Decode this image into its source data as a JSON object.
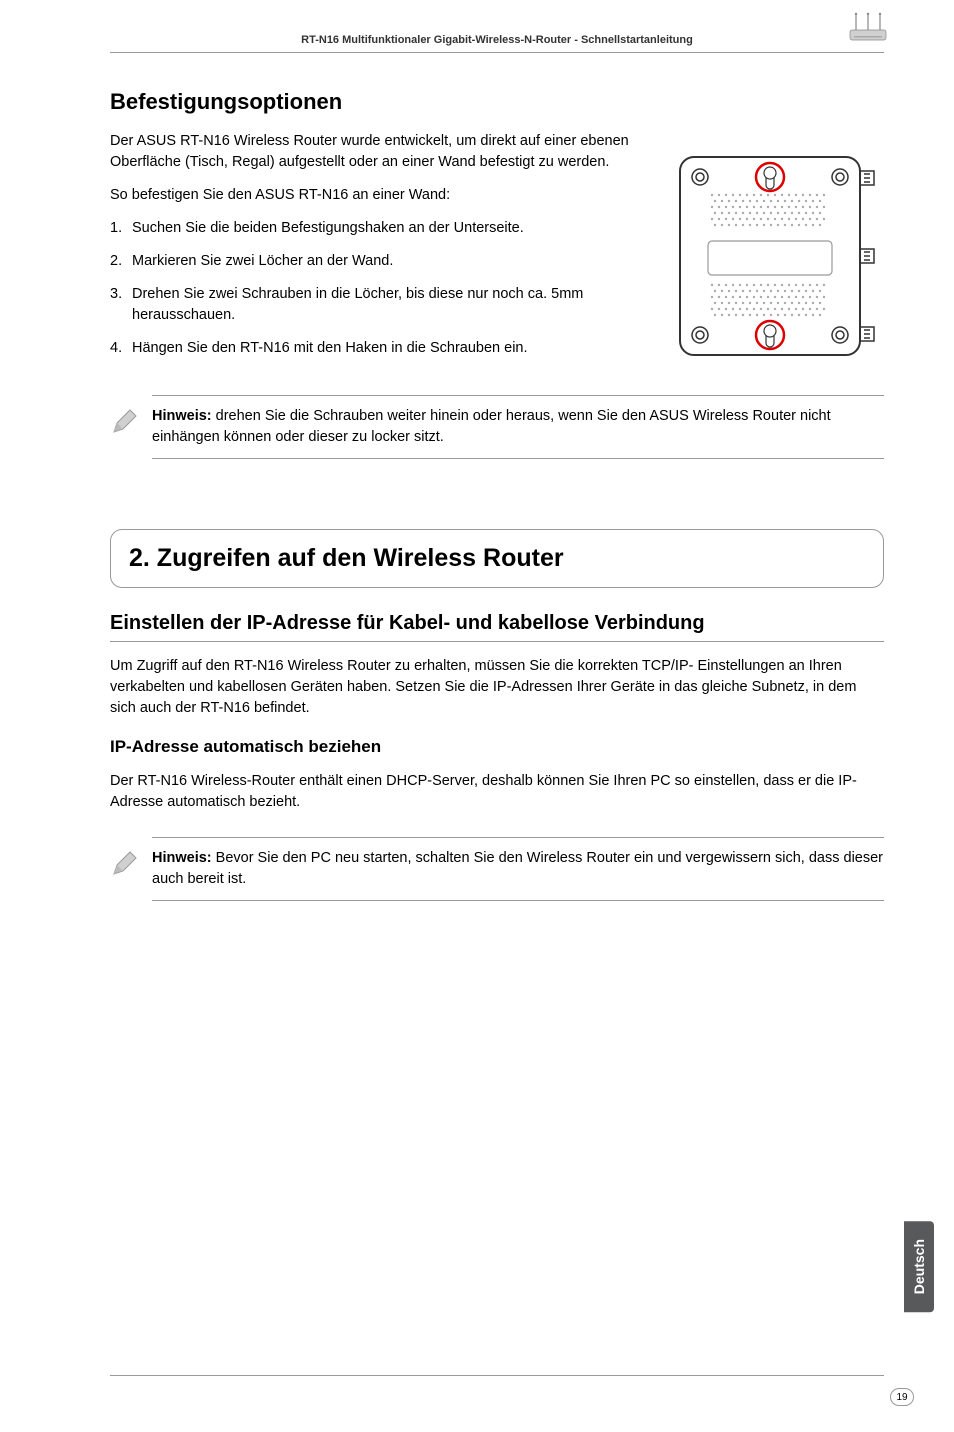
{
  "header": {
    "breadcrumb": "RT-N16 Multifunktionaler Gigabit-Wireless-N-Router - Schnellstartanleitung"
  },
  "mount": {
    "heading": "Befestigungsoptionen",
    "intro1": "Der ASUS RT-N16 Wireless Router wurde entwickelt, um direkt auf einer ebenen Oberfläche (Tisch, Regal) aufgestellt oder an einer Wand befestigt zu werden.",
    "intro2": "So befestigen Sie den ASUS RT-N16 an einer Wand:",
    "steps": [
      "Suchen Sie die beiden Befestigungshaken an der Unterseite.",
      "Markieren Sie zwei Löcher an der Wand.",
      "Drehen Sie zwei Schrauben in die Löcher, bis diese nur noch ca. 5mm herausschauen.",
      "Hängen Sie den RT-N16 mit den Haken in die Schrauben ein."
    ],
    "note_label": "Hinweis:",
    "note_text": " drehen Sie die Schrauben weiter hinein oder heraus, wenn Sie den ASUS Wireless Router nicht einhängen können oder dieser zu locker sitzt."
  },
  "section2": {
    "title": "2. Zugreifen auf den Wireless Router",
    "subhead": "Einstellen der IP-Adresse für Kabel- und kabellose Verbindung",
    "p1": "Um Zugriff auf den RT-N16 Wireless Router zu erhalten, müssen Sie die korrekten TCP/IP- Einstellungen an Ihren verkabelten und kabellosen Geräten haben. Setzen Sie die IP-Adressen Ihrer Geräte in das gleiche Subnetz, in dem sich auch der RT-N16 befindet.",
    "subsub": "IP-Adresse automatisch beziehen",
    "p2": "Der RT-N16 Wireless-Router enthält einen DHCP-Server, deshalb können Sie Ihren PC so einstellen, dass er die IP-Adresse automatisch bezieht.",
    "note_label": "Hinweis:",
    "note_text": " Bevor Sie den PC neu starten, schalten Sie den Wireless Router ein und vergewissern sich, dass dieser auch bereit ist."
  },
  "sidebar": {
    "lang": "Deutsch"
  },
  "footer": {
    "page": "19"
  }
}
